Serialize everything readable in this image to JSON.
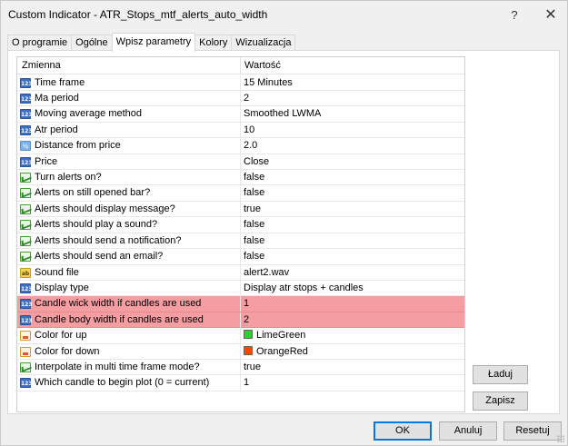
{
  "window": {
    "title": "Custom Indicator - ATR_Stops_mtf_alerts_auto_width",
    "help_glyph": "?",
    "close_glyph": "✕"
  },
  "tabs": [
    {
      "label": "O programie",
      "active": false
    },
    {
      "label": "Ogólne",
      "active": false
    },
    {
      "label": "Wpisz parametry",
      "active": true
    },
    {
      "label": "Kolory",
      "active": false
    },
    {
      "label": "Wizualizacja",
      "active": false
    }
  ],
  "grid": {
    "headers": {
      "variable": "Zmienna",
      "value": "Wartość"
    },
    "rows": [
      {
        "icon": "int",
        "icon_text": "123",
        "name": "Time frame",
        "value": "15 Minutes"
      },
      {
        "icon": "int",
        "icon_text": "123",
        "name": "Ma period",
        "value": "2"
      },
      {
        "icon": "int",
        "icon_text": "123",
        "name": "Moving average method",
        "value": "Smoothed LWMA"
      },
      {
        "icon": "int",
        "icon_text": "123",
        "name": "Atr period",
        "value": "10"
      },
      {
        "icon": "dbl",
        "icon_text": "½",
        "name": "Distance from price",
        "value": "2.0"
      },
      {
        "icon": "int",
        "icon_text": "123",
        "name": "Price",
        "value": "Close"
      },
      {
        "icon": "bool",
        "icon_text": "",
        "name": "Turn alerts on?",
        "value": "false"
      },
      {
        "icon": "bool",
        "icon_text": "",
        "name": "Alerts on still opened bar?",
        "value": "false"
      },
      {
        "icon": "bool",
        "icon_text": "",
        "name": "Alerts should display message?",
        "value": "true"
      },
      {
        "icon": "bool",
        "icon_text": "",
        "name": "Alerts should play a sound?",
        "value": "false"
      },
      {
        "icon": "bool",
        "icon_text": "",
        "name": "Alerts should send a notification?",
        "value": "false"
      },
      {
        "icon": "bool",
        "icon_text": "",
        "name": "Alerts should send an email?",
        "value": "false"
      },
      {
        "icon": "str",
        "icon_text": "ab",
        "name": "Sound file",
        "value": "alert2.wav"
      },
      {
        "icon": "int",
        "icon_text": "123",
        "name": "Display type",
        "value": "Display atr stops + candles"
      },
      {
        "icon": "int",
        "icon_text": "123",
        "name": "Candle wick width if candles are used",
        "value": "1",
        "highlighted": true
      },
      {
        "icon": "int",
        "icon_text": "123",
        "name": "Candle body width if candles are used",
        "value": "2",
        "highlighted": true
      },
      {
        "icon": "color",
        "icon_text": "",
        "name": "Color for up",
        "value": "LimeGreen",
        "swatch": "#32cd32"
      },
      {
        "icon": "color",
        "icon_text": "",
        "name": "Color for down",
        "value": "OrangeRed",
        "swatch": "#ff4500"
      },
      {
        "icon": "bool",
        "icon_text": "",
        "name": "Interpolate in multi time frame mode?",
        "value": "true"
      },
      {
        "icon": "int",
        "icon_text": "123",
        "name": "Which candle to begin plot (0 = current)",
        "value": "1"
      }
    ]
  },
  "side_buttons": {
    "load": "Ładuj",
    "save": "Zapisz"
  },
  "footer_buttons": {
    "ok": "OK",
    "cancel": "Anuluj",
    "reset": "Resetuj"
  },
  "colors": {
    "highlight": "#f59ea2",
    "accent": "#0078d7"
  }
}
